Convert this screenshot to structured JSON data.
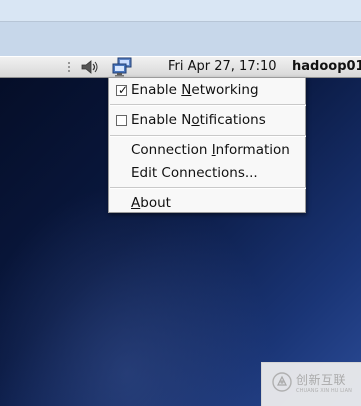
{
  "panel": {
    "clock": "Fri Apr 27, 17:10",
    "hostname": "hadoop01"
  },
  "menu": {
    "items": [
      {
        "label": "Enable Networking",
        "checked": true
      },
      {
        "label": "Enable Notifications",
        "checked": false
      },
      {
        "label": "Connection Information"
      },
      {
        "label": "Edit Connections..."
      },
      {
        "label": "About"
      }
    ]
  },
  "watermark": {
    "title": "创新互联",
    "subtitle": "CHUANG XIN HU LIAN"
  },
  "colors": {
    "desktop_dark": "#050e28",
    "desktop_light": "#2b4b96",
    "panel": "#e5e5e5",
    "menu_bg": "#f8f8f8"
  },
  "icons": {
    "volume": "volume-icon",
    "network": "network-icon",
    "checkbox": "checkbox-icon",
    "watermark_logo": "logo-icon"
  }
}
